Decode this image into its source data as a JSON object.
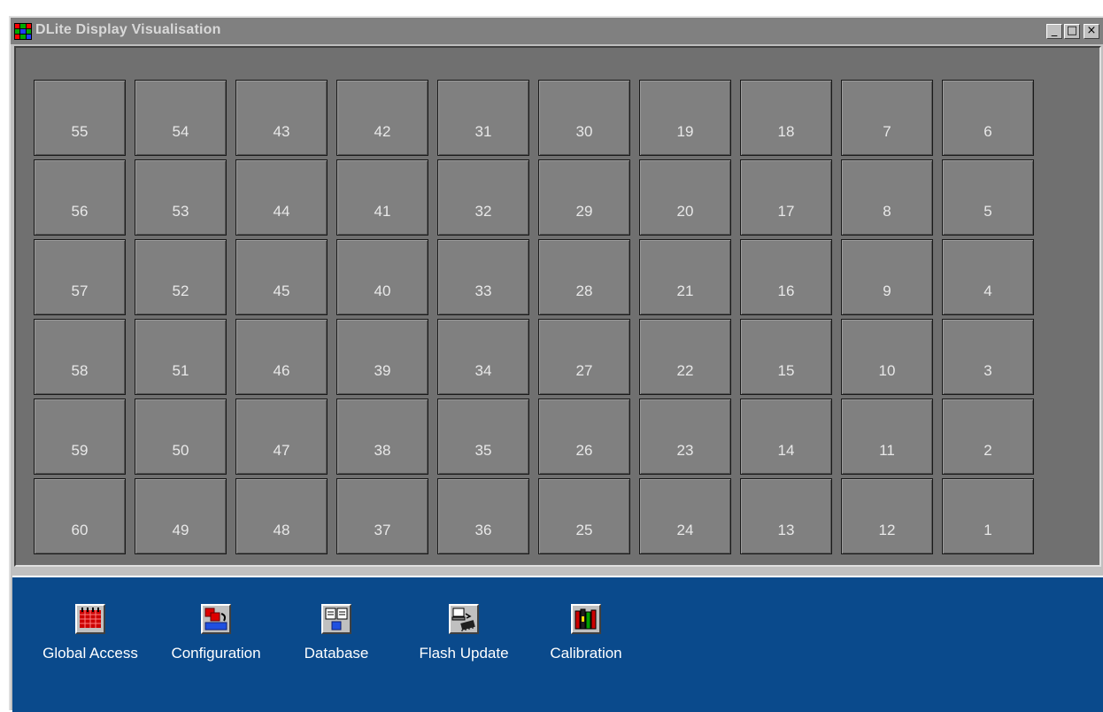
{
  "window": {
    "title": "DLite Display Visualisation",
    "controls": {
      "minimize": "_",
      "maximize": "□",
      "close": "×"
    }
  },
  "grid": {
    "rows": [
      [
        "55",
        "54",
        "43",
        "42",
        "31",
        "30",
        "19",
        "18",
        "7",
        "6"
      ],
      [
        "56",
        "53",
        "44",
        "41",
        "32",
        "29",
        "20",
        "17",
        "8",
        "5"
      ],
      [
        "57",
        "52",
        "45",
        "40",
        "33",
        "28",
        "21",
        "16",
        "9",
        "4"
      ],
      [
        "58",
        "51",
        "46",
        "39",
        "34",
        "27",
        "22",
        "15",
        "10",
        "3"
      ],
      [
        "59",
        "50",
        "47",
        "38",
        "35",
        "26",
        "23",
        "14",
        "11",
        "2"
      ],
      [
        "60",
        "49",
        "48",
        "37",
        "36",
        "25",
        "24",
        "13",
        "12",
        "1"
      ]
    ]
  },
  "toolbar": {
    "items": [
      {
        "label": "Global Access",
        "icon": "calendar-grid-icon"
      },
      {
        "label": "Configuration",
        "icon": "configuration-icon"
      },
      {
        "label": "Database",
        "icon": "database-icon"
      },
      {
        "label": "Flash Update",
        "icon": "flash-update-icon"
      },
      {
        "label": "Calibration",
        "icon": "calibration-icon"
      }
    ]
  },
  "colors": {
    "display_background": "#707070",
    "tile": "#808080",
    "toolbar_background": "#0a4a8c",
    "titlebar": "#808080"
  }
}
